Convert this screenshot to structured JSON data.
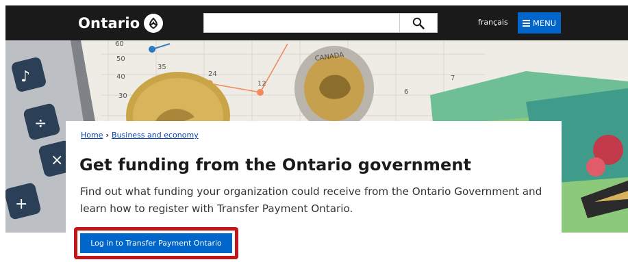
{
  "header": {
    "logo_text": "Ontario",
    "search": {
      "value": "",
      "placeholder": ""
    },
    "language_link": "français",
    "menu_label": "MENU"
  },
  "hero": {
    "chart_point_labels": [
      "35",
      "24",
      "12",
      "6",
      "7"
    ],
    "axis_labels": [
      "60",
      "50",
      "40",
      "30"
    ],
    "coin_text": "CANADA"
  },
  "breadcrumb": {
    "items": [
      "Home",
      "Business and economy"
    ]
  },
  "page": {
    "title": "Get funding from the Ontario government",
    "description": "Find out what funding your organization could receive from the Ontario Government and learn how to register with Transfer Payment Ontario.",
    "cta_label": "Log in to Transfer Payment Ontario"
  },
  "colors": {
    "header_bg": "#1a1a1a",
    "accent_blue": "#0066cc",
    "highlight_red": "#c0151b",
    "link_blue": "#0645ad"
  }
}
